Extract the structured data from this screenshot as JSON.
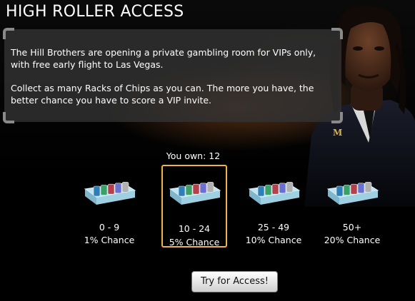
{
  "title": "HIGH ROLLER ACCESS",
  "info": {
    "paragraph1": "The Hill Brothers are opening a private gambling room for VIPs only, with free early flight to Las Vegas.",
    "paragraph2": "Collect as many Racks of Chips as you can. The more you have, the better chance you have to score a VIP invite."
  },
  "owned": "You own: 12",
  "tiers": [
    {
      "range": "0 - 9",
      "chance": "1% Chance"
    },
    {
      "range": "10 - 24",
      "chance": "5% Chance"
    },
    {
      "range": "25 - 49",
      "chance": "10% Chance"
    },
    {
      "range": "50+",
      "chance": "20% Chance"
    }
  ],
  "selected_tier": 1,
  "action_button": "Try for Access!",
  "colors": {
    "highlight": "#f0b24a",
    "panel": "#323232"
  }
}
